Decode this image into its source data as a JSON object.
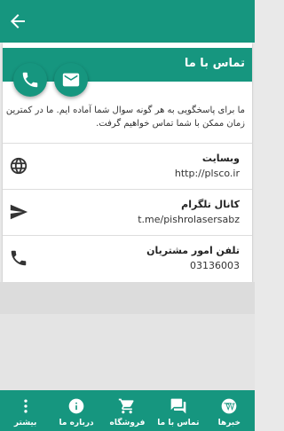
{
  "colors": {
    "primary": "#16967f",
    "background": "#e9e9e9",
    "card": "#ffffff"
  },
  "header": {
    "back_icon": "arrow-back-icon"
  },
  "contact_card": {
    "title": "تماس با ما",
    "description": "ما برای پاسخگویی به هر گونه سوال شما آماده ایم. ما در کمترین زمان ممکن با شما تماس خواهیم گرفت.",
    "fab_phone_icon": "phone-icon",
    "fab_email_icon": "email-icon"
  },
  "contact_rows": [
    {
      "title": "وبسایت",
      "value": "http://plsco.ir",
      "icon": "globe-icon"
    },
    {
      "title": "کانال تلگرام",
      "value": "t.me/pishrolasersabz",
      "icon": "send-icon"
    },
    {
      "title": "تلفن امور مشتریان",
      "value": "03136003",
      "icon": "phone-icon"
    }
  ],
  "bottom_nav": [
    {
      "label": "خبرها",
      "icon": "wordpress-icon"
    },
    {
      "label": "تماس با ما",
      "icon": "chat-icon"
    },
    {
      "label": "فروشگاه",
      "icon": "cart-icon"
    },
    {
      "label": "درباره ما",
      "icon": "info-icon"
    },
    {
      "label": "بیشتر",
      "icon": "more-vertical-icon"
    }
  ]
}
